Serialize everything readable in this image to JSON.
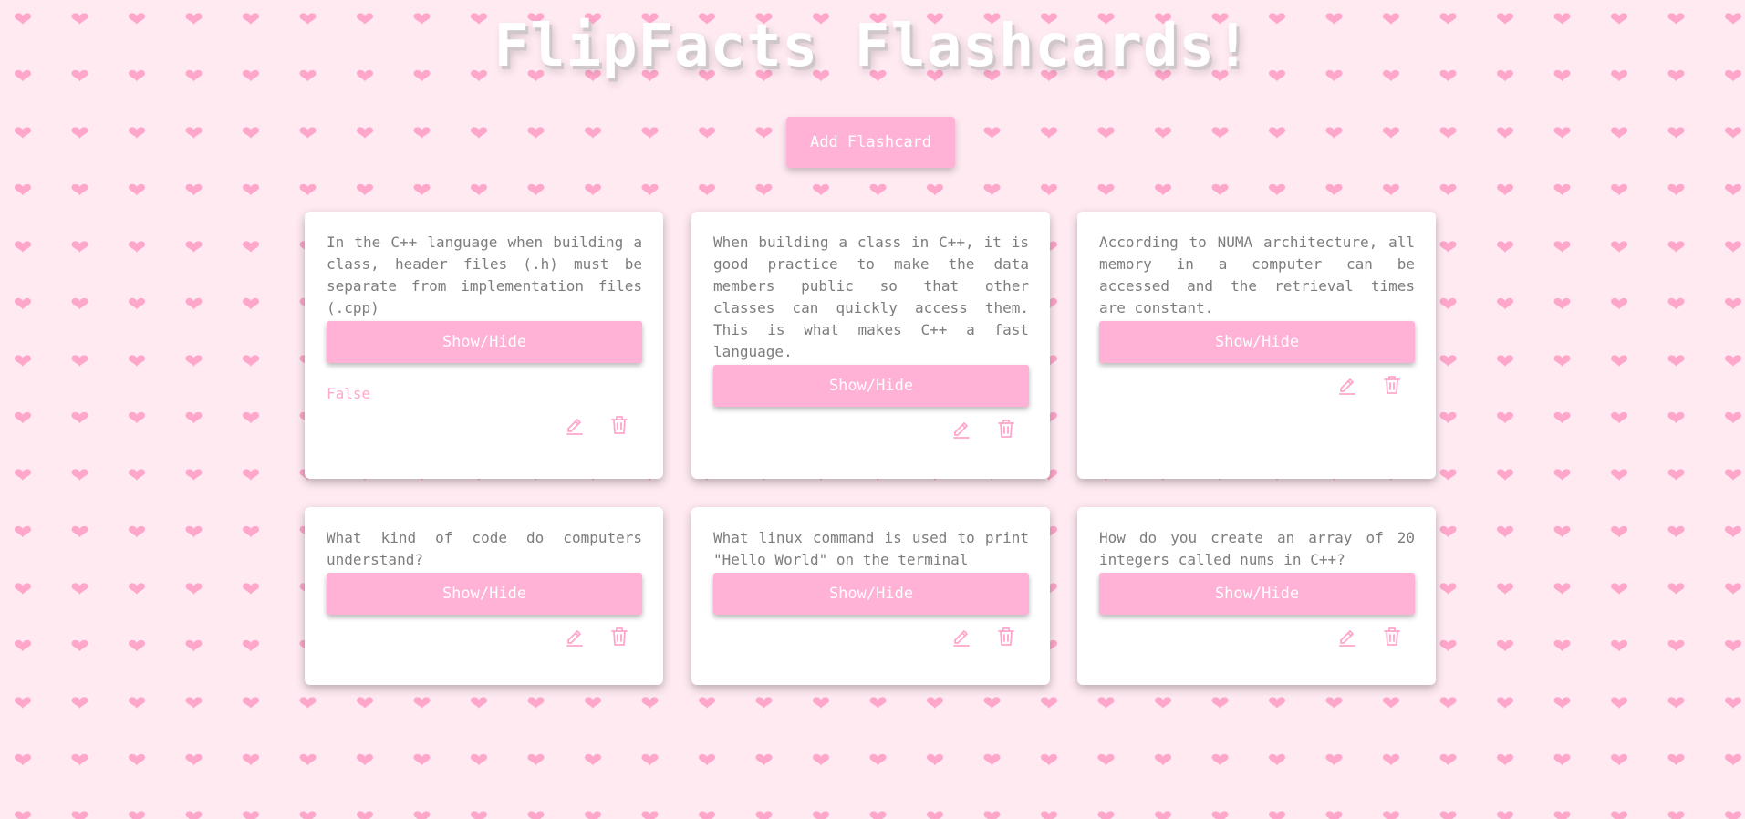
{
  "page": {
    "title": "FlipFacts Flashcards!",
    "add_button_label": "Add Flashcard"
  },
  "colors": {
    "background": "#ffeaf2",
    "heart": "#ffa6cb",
    "accent": "#ffb1d6",
    "answer_text": "#ffaacd",
    "question_text": "#7d7d7d"
  },
  "icons": {
    "background_pattern": "heart-icon",
    "edit": "pencil-icon",
    "delete": "trash-icon"
  },
  "cards": [
    {
      "question": "In the C++ language when building a class, header files (.h) must be separate from implementation files (.cpp)",
      "button_label": "Show/Hide",
      "answer": "False"
    },
    {
      "question": "When building a class in C++, it is good practice to make the data members public so that other classes can quickly access them. This is what makes C++ a fast language.",
      "button_label": "Show/Hide",
      "answer": ""
    },
    {
      "question": "According to NUMA architecture, all memory in a computer can be accessed and the retrieval times are constant.",
      "button_label": "Show/Hide",
      "answer": ""
    },
    {
      "question": "What kind of code do computers understand?",
      "button_label": "Show/Hide",
      "answer": ""
    },
    {
      "question": "What linux command is used to print \"Hello World\" on the terminal",
      "button_label": "Show/Hide",
      "answer": ""
    },
    {
      "question": "How do you create an array of 20 integers called nums in C++?",
      "button_label": "Show/Hide",
      "answer": ""
    }
  ]
}
